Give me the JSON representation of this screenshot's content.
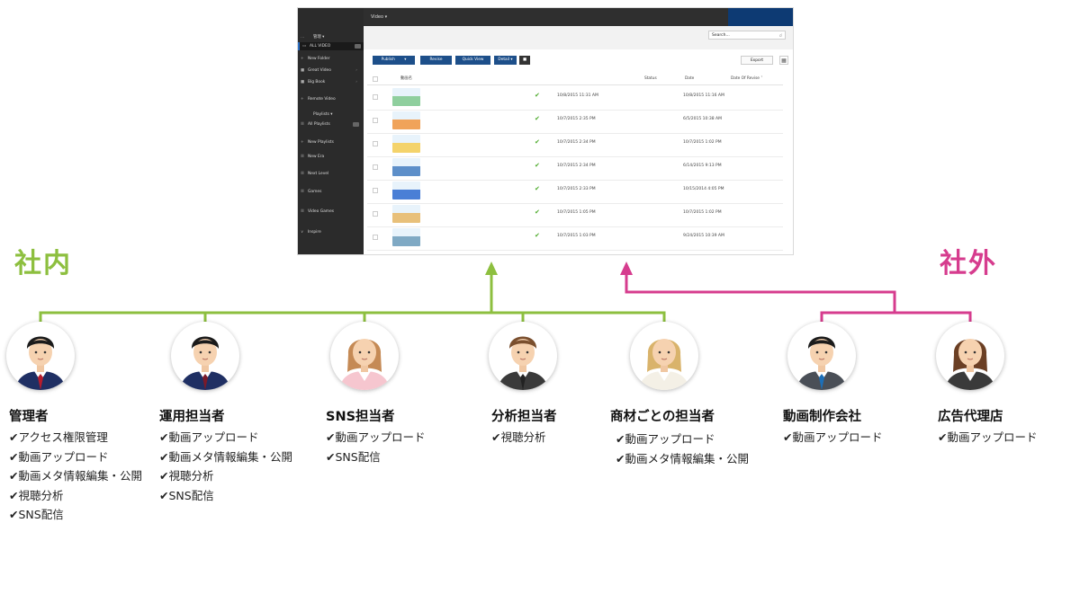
{
  "screenshot": {
    "topbar_title": "Video ▾",
    "search_placeholder": "Search...",
    "sidebar": [
      {
        "icon": "…",
        "label": "管理 ▾",
        "kind": "header"
      },
      {
        "icon": "▭",
        "label": "ALL VIDEO",
        "kind": "selected",
        "count": ""
      },
      {
        "icon": "+",
        "label": "New Folder",
        "kind": "item"
      },
      {
        "icon": "■",
        "label": "Great Video",
        "kind": "folder"
      },
      {
        "icon": "■",
        "label": "Big Book",
        "kind": "folder"
      },
      {
        "icon": "+",
        "label": "Remote Video",
        "kind": "item"
      },
      {
        "icon": "",
        "label": "Playlists ▾",
        "kind": "header"
      },
      {
        "icon": "☰",
        "label": "All Playlists",
        "kind": "count",
        "count": ""
      },
      {
        "icon": "+",
        "label": "New Playlists",
        "kind": "item"
      },
      {
        "icon": "☰",
        "label": "New Era",
        "kind": "item"
      },
      {
        "icon": "☰",
        "label": "Next Level",
        "kind": "item"
      },
      {
        "icon": "☰",
        "label": "Games",
        "kind": "item"
      },
      {
        "icon": "☰",
        "label": "Video Games",
        "kind": "item"
      },
      {
        "icon": "∨",
        "label": "Inspire",
        "kind": "item"
      }
    ],
    "toolbar": {
      "publish": "Publish",
      "revise": "Revise",
      "quick_view": "Quick View",
      "detail": "Detail ▾",
      "delete_icon": "🗑",
      "export": "Export"
    },
    "columns": {
      "name": "動画名",
      "status": "Status",
      "date": "Date",
      "date_of_revise": "Date Of Revise ˅"
    },
    "rows": [
      {
        "thumb": "#8fcf9e",
        "status": "✔",
        "date": "10/8/2015 11:31 AM",
        "revise": "10/8/2015 11:16 AM"
      },
      {
        "thumb": "#f0a35a",
        "status": "✔",
        "date": "10/7/2015 2:35 PM",
        "revise": "6/5/2015 10:38 AM"
      },
      {
        "thumb": "#f4d36b",
        "status": "✔",
        "date": "10/7/2015 2:34 PM",
        "revise": "10/7/2015 1:02 PM"
      },
      {
        "thumb": "#5d8fc9",
        "status": "✔",
        "date": "10/7/2015 2:34 PM",
        "revise": "6/14/2015 9:13 PM"
      },
      {
        "thumb": "#4a7fd6",
        "status": "✔",
        "date": "10/7/2015 2:33 PM",
        "revise": "10/15/2014 4:05 PM"
      },
      {
        "thumb": "#e8c07a",
        "status": "✔",
        "date": "10/7/2015 1:05 PM",
        "revise": "10/7/2015 1:02 PM"
      },
      {
        "thumb": "#7fa9c4",
        "status": "✔",
        "date": "10/7/2015 1:03 PM",
        "revise": "9/24/2015 10:39 AM"
      }
    ]
  },
  "groups": {
    "internal": "社内",
    "external": "社外"
  },
  "colors": {
    "internal": "#8dbf3f",
    "external": "#d63c8e",
    "suit_navy": "#1f2f63",
    "suit_gray": "#3a3a3a"
  },
  "roles": [
    {
      "name": "管理者",
      "perms": [
        "✔アクセス権限管理",
        "✔動画アップロード",
        "✔動画メタ情報編集・公開",
        "✔視聴分析",
        "✔SNS配信"
      ]
    },
    {
      "name": "運用担当者",
      "perms": [
        "✔動画アップロード",
        "✔動画メタ情報編集・公開",
        "✔視聴分析",
        "✔SNS配信"
      ]
    },
    {
      "name": "SNS担当者",
      "perms": [
        "✔動画アップロード",
        "✔SNS配信"
      ]
    },
    {
      "name": "分析担当者",
      "perms": [
        "✔視聴分析"
      ]
    },
    {
      "name": "商材ごとの担当者",
      "perms": [
        "✔動画アップロード",
        "✔動画メタ情報編集・公開"
      ]
    },
    {
      "name": "動画制作会社",
      "perms": [
        "✔動画アップロード"
      ]
    },
    {
      "name": "広告代理店",
      "perms": [
        "✔動画アップロード"
      ]
    }
  ]
}
